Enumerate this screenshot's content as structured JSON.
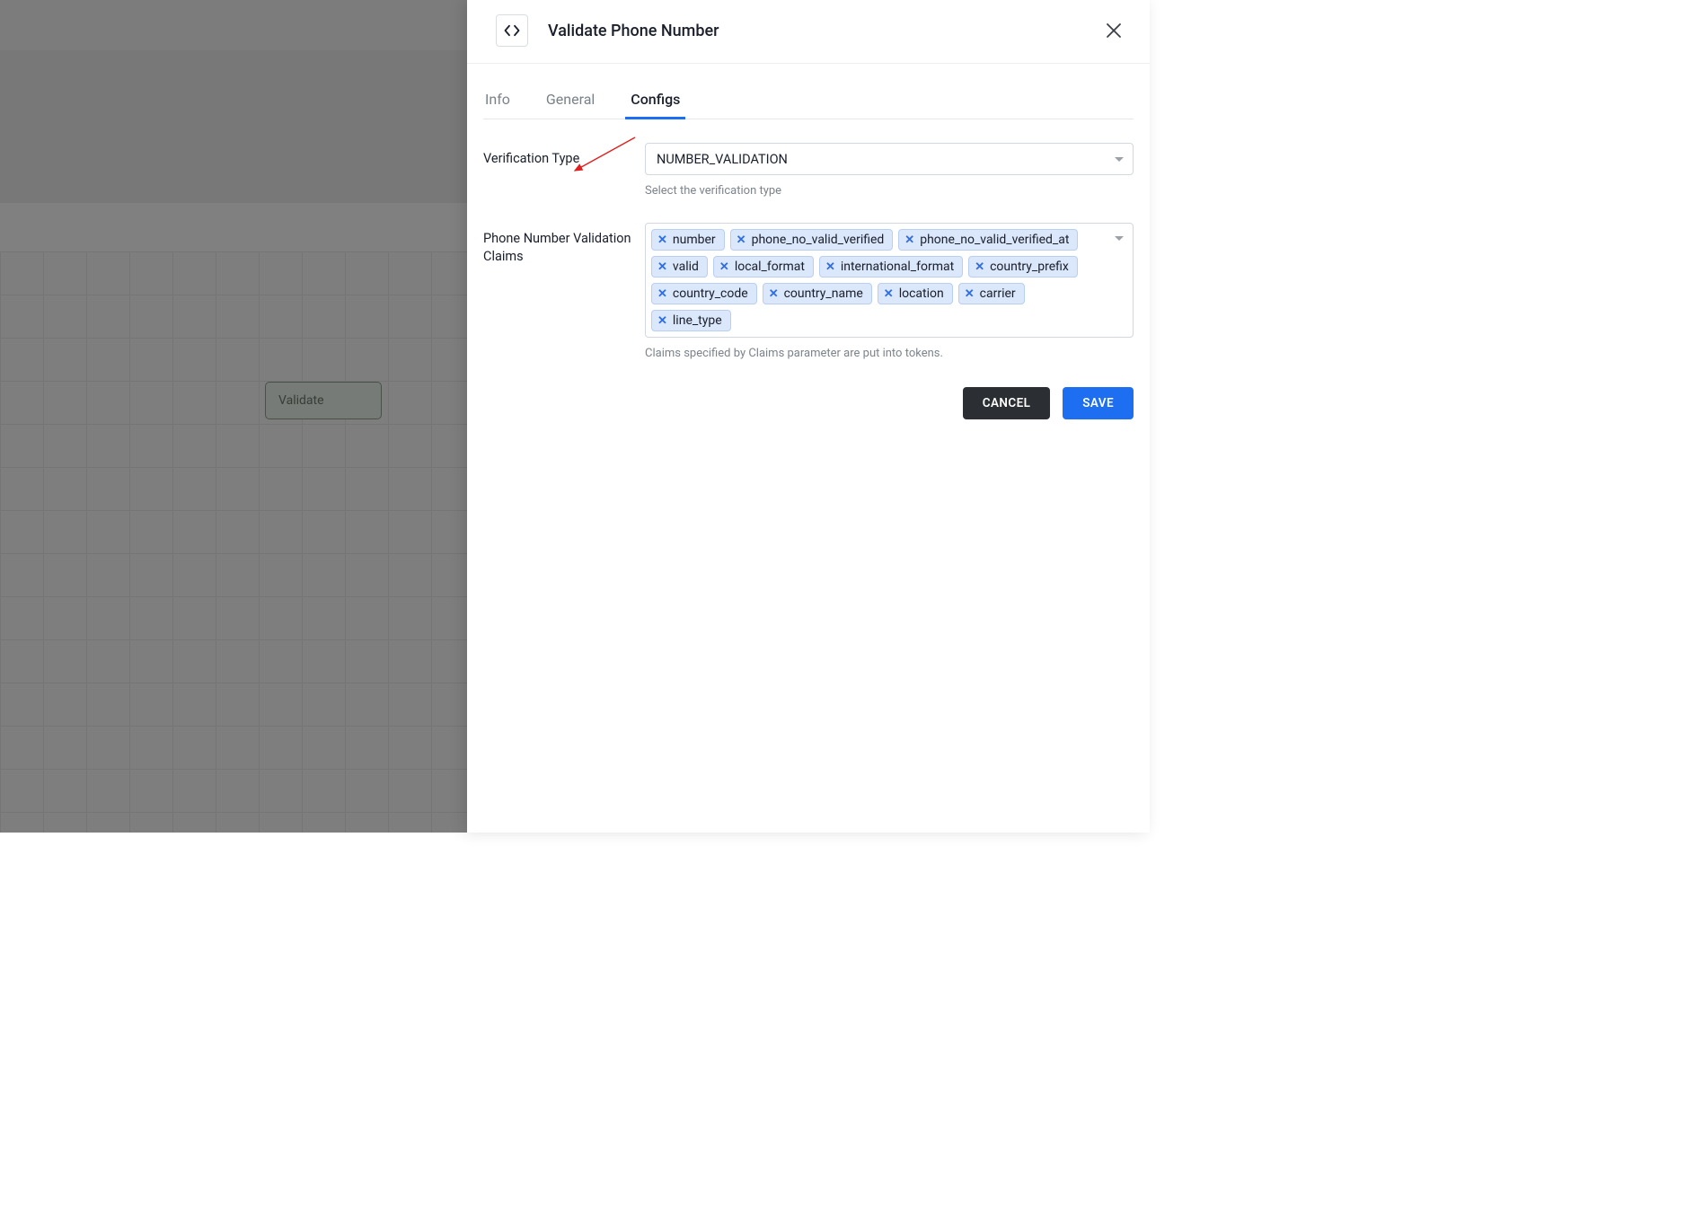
{
  "background": {
    "node_label": "Validate"
  },
  "panel": {
    "title": "Validate Phone Number",
    "tabs": {
      "info": "Info",
      "general": "General",
      "configs": "Configs",
      "active": "configs"
    },
    "verification_type": {
      "label": "Verification Type",
      "value": "NUMBER_VALIDATION",
      "helper": "Select the verification type"
    },
    "claims": {
      "label": "Phone Number Validation Claims",
      "items": [
        "number",
        "phone_no_valid_verified",
        "phone_no_valid_verified_at",
        "valid",
        "local_format",
        "international_format",
        "country_prefix",
        "country_code",
        "country_name",
        "location",
        "carrier",
        "line_type"
      ],
      "helper": "Claims specified by Claims parameter are put into tokens."
    },
    "buttons": {
      "cancel": "CANCEL",
      "save": "SAVE"
    }
  }
}
